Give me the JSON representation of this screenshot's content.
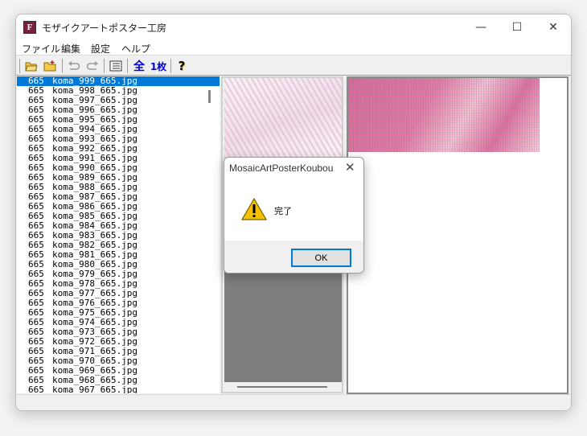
{
  "window": {
    "title": "モザイクアートポスター工房",
    "icon_letter": "F",
    "controls": {
      "minimize": "—",
      "maximize": "☐",
      "close": "✕"
    }
  },
  "menu": [
    "ファイル",
    "編集",
    "設定",
    "ヘルプ"
  ],
  "toolbar": {
    "buttons": [
      {
        "name": "open-folder-icon",
        "glyph": "📂"
      },
      {
        "name": "new-folder-icon",
        "glyph": "🗀"
      },
      {
        "name": "undo-icon",
        "glyph": "↶"
      },
      {
        "name": "redo-icon",
        "glyph": "↷"
      },
      {
        "name": "list-icon",
        "glyph": "☰"
      }
    ],
    "all_label": "全",
    "one_sheet_label": "1枚",
    "help_glyph": "?"
  },
  "file_list": {
    "selected_index": 0,
    "rows": [
      {
        "num": "665",
        "name": "koma_999_665.jpg"
      },
      {
        "num": "665",
        "name": "koma_998_665.jpg"
      },
      {
        "num": "665",
        "name": "koma_997_665.jpg"
      },
      {
        "num": "665",
        "name": "koma_996_665.jpg"
      },
      {
        "num": "665",
        "name": "koma_995_665.jpg"
      },
      {
        "num": "665",
        "name": "koma_994_665.jpg"
      },
      {
        "num": "665",
        "name": "koma_993_665.jpg"
      },
      {
        "num": "665",
        "name": "koma_992_665.jpg"
      },
      {
        "num": "665",
        "name": "koma_991_665.jpg"
      },
      {
        "num": "665",
        "name": "koma_990_665.jpg"
      },
      {
        "num": "665",
        "name": "koma_989_665.jpg"
      },
      {
        "num": "665",
        "name": "koma_988_665.jpg"
      },
      {
        "num": "665",
        "name": "koma_987_665.jpg"
      },
      {
        "num": "665",
        "name": "koma_986_665.jpg"
      },
      {
        "num": "665",
        "name": "koma_985_665.jpg"
      },
      {
        "num": "665",
        "name": "koma_984_665.jpg"
      },
      {
        "num": "665",
        "name": "koma_983_665.jpg"
      },
      {
        "num": "665",
        "name": "koma_982_665.jpg"
      },
      {
        "num": "665",
        "name": "koma_981_665.jpg"
      },
      {
        "num": "665",
        "name": "koma_980_665.jpg"
      },
      {
        "num": "665",
        "name": "koma_979_665.jpg"
      },
      {
        "num": "665",
        "name": "koma_978_665.jpg"
      },
      {
        "num": "665",
        "name": "koma_977_665.jpg"
      },
      {
        "num": "665",
        "name": "koma_976_665.jpg"
      },
      {
        "num": "665",
        "name": "koma_975_665.jpg"
      },
      {
        "num": "665",
        "name": "koma_974_665.jpg"
      },
      {
        "num": "665",
        "name": "koma_973_665.jpg"
      },
      {
        "num": "665",
        "name": "koma_972_665.jpg"
      },
      {
        "num": "665",
        "name": "koma_971_665.jpg"
      },
      {
        "num": "665",
        "name": "koma_970_665.jpg"
      },
      {
        "num": "665",
        "name": "koma_969_665.jpg"
      },
      {
        "num": "665",
        "name": "koma_968_665.jpg"
      },
      {
        "num": "665",
        "name": "koma_967_665.jpg"
      }
    ]
  },
  "dialog": {
    "title": "MosaicArtPosterKoubou",
    "close_glyph": "✕",
    "message": "完了",
    "icon": "warning-icon",
    "ok_label": "OK"
  },
  "colors": {
    "selection": "#0078d7",
    "warning_fill": "#f2c200"
  }
}
